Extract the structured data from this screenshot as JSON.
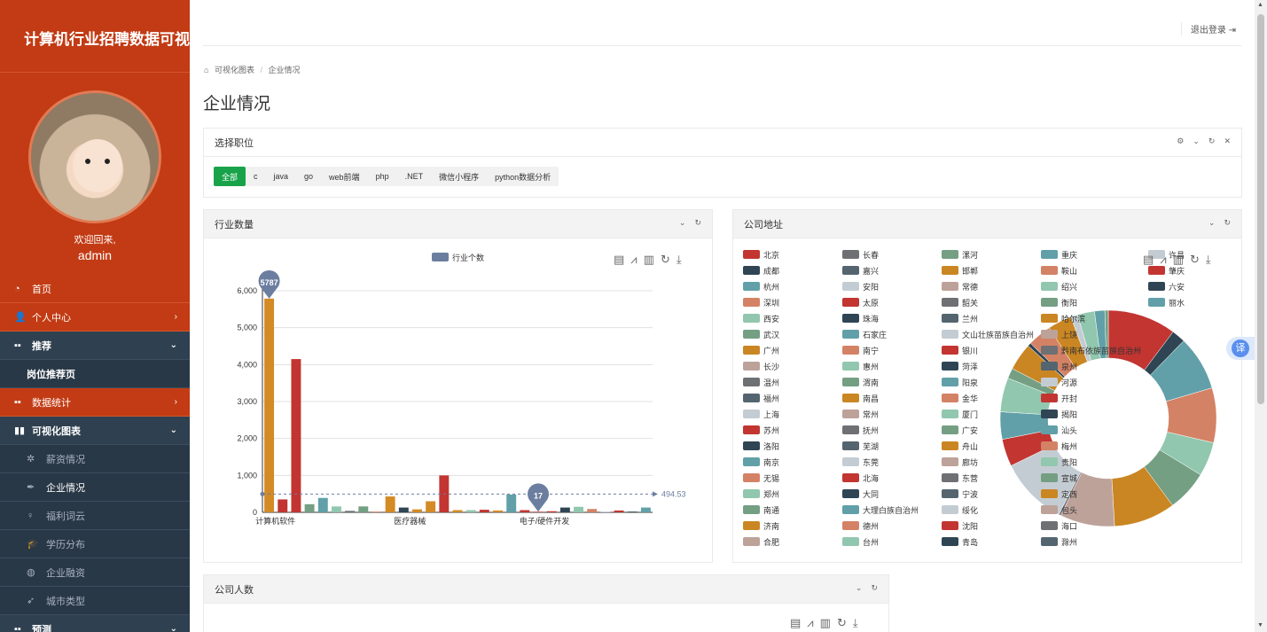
{
  "sidebar": {
    "brand": "计算机行业招聘数据可视化",
    "welcome": "欢迎回来,",
    "username": "admin",
    "items": [
      {
        "label": "首页",
        "icon": "gauge-icon",
        "style": "orange"
      },
      {
        "label": "个人中心",
        "icon": "user-icon",
        "style": "orange",
        "arrow": "›"
      },
      {
        "label": "推荐",
        "icon": "grid-icon",
        "style": "dark",
        "arrow": "⌄"
      },
      {
        "label": "岗位推荐页",
        "style": "sub-plain"
      },
      {
        "label": "数据统计",
        "icon": "grid-icon",
        "style": "orange",
        "arrow": "›"
      },
      {
        "label": "可视化图表",
        "icon": "bar-chart-icon",
        "style": "dark",
        "arrow": "⌄"
      },
      {
        "label": "薪资情况",
        "icon": "sun-icon",
        "style": "sub-dim"
      },
      {
        "label": "企业情况",
        "icon": "pen-icon",
        "style": "sub-active"
      },
      {
        "label": "福利词云",
        "icon": "bulb-icon",
        "style": "sub-dim"
      },
      {
        "label": "学历分布",
        "icon": "graduation-icon",
        "style": "sub-dim"
      },
      {
        "label": "企业融资",
        "icon": "globe-icon",
        "style": "sub-dim"
      },
      {
        "label": "城市类型",
        "icon": "rocket-icon",
        "style": "sub-dim"
      },
      {
        "label": "预测",
        "icon": "grid-icon",
        "style": "dark",
        "arrow": "⌄"
      }
    ]
  },
  "topbar": {
    "logout": "退出登录"
  },
  "breadcrumb": {
    "home": "可视化图表",
    "sep": "/",
    "current": "企业情况"
  },
  "page_title": "企业情况",
  "job_filter": {
    "title": "选择职位",
    "buttons": [
      "全部",
      "c",
      "java",
      "go",
      "web前端",
      "php",
      ".NET",
      "微信小程序",
      "python数据分析"
    ],
    "active_index": 0
  },
  "industry_panel": {
    "title": "行业数量"
  },
  "address_panel": {
    "title": "公司地址"
  },
  "people_panel": {
    "title": "公司人数"
  },
  "chart_data": [
    {
      "type": "bar",
      "legend": [
        "行业个数"
      ],
      "categories_shown": [
        "计算机软件",
        "医疗器械",
        "电子/硬件开发"
      ],
      "ylim": [
        0,
        6000
      ],
      "yticks": [
        "0",
        "1,000",
        "2,000",
        "3,000",
        "4,000",
        "5,000",
        "6,000"
      ],
      "values": [
        5787,
        350,
        4150,
        220,
        390,
        160,
        40,
        160,
        20,
        430,
        130,
        80,
        300,
        1000,
        60,
        60,
        70,
        50,
        480,
        60,
        17,
        30,
        130,
        150,
        90,
        20,
        50,
        20,
        130
      ],
      "colors": [
        "#d48a25",
        "#c23531",
        "#c23531",
        "#749f83",
        "#61a0a8",
        "#91c7ae",
        "#6e7074",
        "#749f83",
        "#d48265",
        "#d48a25",
        "#2f4554",
        "#d48a25",
        "#d48a25",
        "#c23531",
        "#d48a25",
        "#91c7ae",
        "#c23531",
        "#d48a25",
        "#61a0a8",
        "#c23531",
        "#c23531",
        "#c23531",
        "#2f4554",
        "#91c7ae",
        "#d48265",
        "#c4ccd3",
        "#c23531",
        "#2f4554",
        "#61a0a8"
      ],
      "max_label": "5787",
      "min_label": "17",
      "average_label": "494.53",
      "average": 494.53
    },
    {
      "type": "pie",
      "legend": [
        "北京",
        "长春",
        "漯河",
        "重庆",
        "许昌",
        "成都",
        "嘉兴",
        "邯郸",
        "鞍山",
        "肇庆",
        "杭州",
        "安阳",
        "常德",
        "绍兴",
        "六安",
        "深圳",
        "太原",
        "韶关",
        "衡阳",
        "丽水",
        "西安",
        "珠海",
        "兰州",
        "哈尔滨",
        "",
        "武汉",
        "石家庄",
        "文山壮族苗族自治州",
        "上饶",
        "",
        "广州",
        "南宁",
        "银川",
        "黔南布依族苗族自治州",
        "",
        "长沙",
        "惠州",
        "菏泽",
        "泉州",
        "",
        "温州",
        "渭南",
        "阳泉",
        "河源",
        "",
        "福州",
        "南昌",
        "金华",
        "开封",
        "",
        "上海",
        "常州",
        "厦门",
        "揭阳",
        "",
        "苏州",
        "抚州",
        "广安",
        "汕头",
        "",
        "洛阳",
        "芜湖",
        "舟山",
        "梅州",
        "",
        "南京",
        "东莞",
        "廊坊",
        "贵阳",
        "",
        "无锡",
        "北海",
        "东营",
        "宣城",
        "",
        "郑州",
        "大同",
        "宁波",
        "定西",
        "",
        "南通",
        "大理白族自治州",
        "绥化",
        "包头",
        "",
        "济南",
        "德州",
        "沈阳",
        "海口",
        "",
        "合肥",
        "台州",
        "青岛",
        "滁州",
        ""
      ],
      "legend_colors": [
        "#c23531",
        "#6e7074",
        "#749f83",
        "#61a0a8",
        "#c4ccd3",
        "#2f4554",
        "#546570",
        "#ca8622",
        "#d48265",
        "#c23531",
        "#61a0a8",
        "#c4ccd3",
        "#bda29a",
        "#91c7ae",
        "#2f4554",
        "#d48265",
        "#c23531",
        "#6e7074",
        "#749f83",
        "#61a0a8",
        "#91c7ae",
        "#2f4554",
        "#546570",
        "#ca8622",
        "",
        "#749f83",
        "#61a0a8",
        "#c4ccd3",
        "#bda29a",
        "",
        "#ca8622",
        "#d48265",
        "#c23531",
        "#6e7074",
        "",
        "#bda29a",
        "#91c7ae",
        "#2f4554",
        "#546570",
        "",
        "#6e7074",
        "#749f83",
        "#61a0a8",
        "#c4ccd3",
        "",
        "#546570",
        "#ca8622",
        "#d48265",
        "#c23531",
        "",
        "#c4ccd3",
        "#bda29a",
        "#91c7ae",
        "#2f4554",
        "",
        "#c23531",
        "#6e7074",
        "#749f83",
        "#61a0a8",
        "",
        "#2f4554",
        "#546570",
        "#ca8622",
        "#d48265",
        "",
        "#61a0a8",
        "#c4ccd3",
        "#bda29a",
        "#91c7ae",
        "",
        "#d48265",
        "#c23531",
        "#6e7074",
        "#749f83",
        "",
        "#91c7ae",
        "#2f4554",
        "#546570",
        "#ca8622",
        "",
        "#749f83",
        "#61a0a8",
        "#c4ccd3",
        "#bda29a",
        "",
        "#ca8622",
        "#d48265",
        "#c23531",
        "#6e7074",
        "",
        "#bda29a",
        "#91c7ae",
        "#2f4554",
        "#546570",
        ""
      ],
      "slices": [
        {
          "color": "#c23531",
          "value": 10
        },
        {
          "color": "#2f4554",
          "value": 2
        },
        {
          "color": "#61a0a8",
          "value": 8
        },
        {
          "color": "#d48265",
          "value": 8
        },
        {
          "color": "#91c7ae",
          "value": 5
        },
        {
          "color": "#749f83",
          "value": 6
        },
        {
          "color": "#ca8622",
          "value": 9
        },
        {
          "color": "#bda29a",
          "value": 8
        },
        {
          "color": "#6e7074",
          "value": 0.3
        },
        {
          "color": "#c4ccd3",
          "value": 10
        },
        {
          "color": "#c23531",
          "value": 4
        },
        {
          "color": "#61a0a8",
          "value": 4
        },
        {
          "color": "#91c7ae",
          "value": 5
        },
        {
          "color": "#749f83",
          "value": 1.5
        },
        {
          "color": "#ca8622",
          "value": 4
        },
        {
          "color": "#2f4554",
          "value": 0.5
        },
        {
          "color": "#d48265",
          "value": 3.5
        },
        {
          "color": "#ca8622",
          "value": 3.5
        },
        {
          "color": "#c4ccd3",
          "value": 1
        },
        {
          "color": "#91c7ae",
          "value": 2.5
        },
        {
          "color": "#61a0a8",
          "value": 1.5
        },
        {
          "color": "#749f83",
          "value": 0.5
        }
      ]
    }
  ]
}
